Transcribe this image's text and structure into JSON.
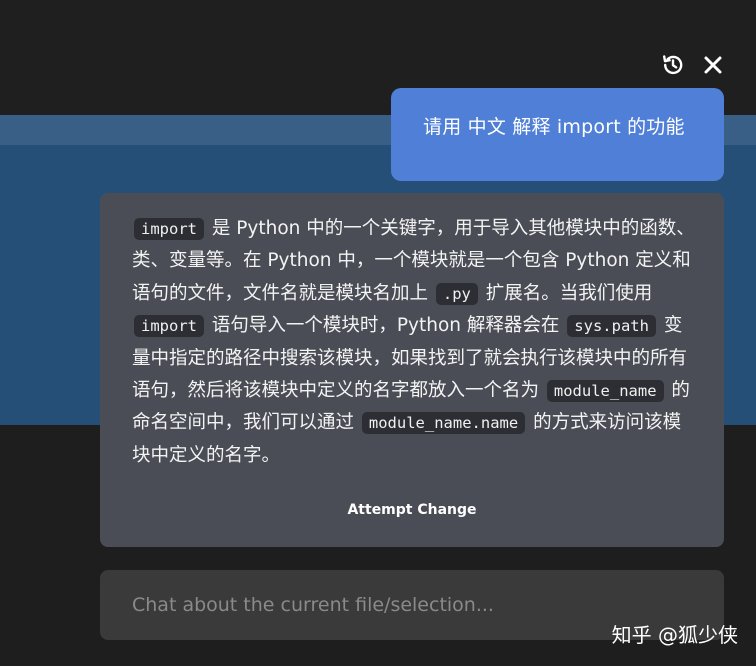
{
  "header": {
    "history_icon": "history-icon",
    "close_icon": "close-icon"
  },
  "user_message": {
    "text": "请用 中文 解释 import 的功能"
  },
  "assistant_message": {
    "segments": [
      {
        "type": "code",
        "text": "import"
      },
      {
        "type": "text",
        "text": " 是 Python 中的一个关键字，用于导入其他模块中的函数、类、变量等。在 Python 中，一个模块就是一个包含 Python 定义和语句的文件，文件名就是模块名加上 "
      },
      {
        "type": "code",
        "text": ".py"
      },
      {
        "type": "text",
        "text": " 扩展名。当我们使用 "
      },
      {
        "type": "code",
        "text": "import"
      },
      {
        "type": "text",
        "text": " 语句导入一个模块时，Python 解释器会在 "
      },
      {
        "type": "code",
        "text": "sys.path"
      },
      {
        "type": "text",
        "text": " 变量中指定的路径中搜索该模块，如果找到了就会执行该模块中的所有语句，然后将该模块中定义的名字都放入一个名为 "
      },
      {
        "type": "code",
        "text": "module_name"
      },
      {
        "type": "text",
        "text": " 的命名空间中，我们可以通过 "
      },
      {
        "type": "code",
        "text": "module_name.name"
      },
      {
        "type": "text",
        "text": " 的方式来访问该模块中定义的名字。"
      }
    ],
    "action_label": "Attempt Change"
  },
  "chat_input": {
    "placeholder": "Chat about the current file/selection...",
    "value": ""
  },
  "watermark": {
    "text": "知乎 @狐少侠"
  },
  "colors": {
    "user_bubble": "#4f7fd6",
    "assistant_panel": "#4a4d55",
    "editor_selection": "#264f78",
    "background": "#1e1e1e"
  }
}
